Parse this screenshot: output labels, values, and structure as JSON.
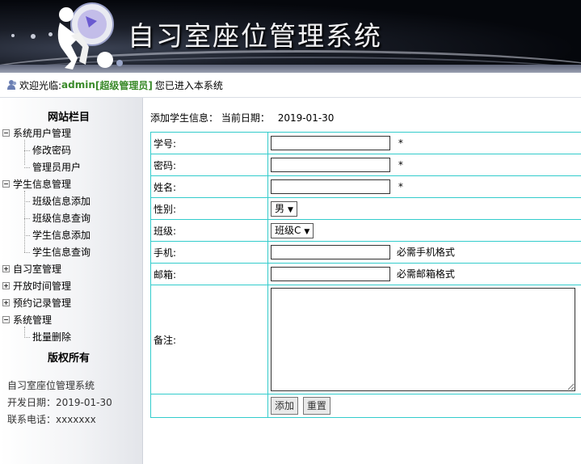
{
  "header": {
    "title": "自习室座位管理系统"
  },
  "welcome": {
    "prefix": "欢迎光临:",
    "username": "admin",
    "role": "[超级管理员]",
    "suffix": "您已进入本系统"
  },
  "sidebar": {
    "title": "网站栏目",
    "groups": [
      {
        "label": "系统用户管理",
        "expanded": true,
        "items": [
          "修改密码",
          "管理员用户"
        ]
      },
      {
        "label": "学生信息管理",
        "expanded": true,
        "items": [
          "班级信息添加",
          "班级信息查询",
          "学生信息添加",
          "学生信息查询"
        ]
      },
      {
        "label": "自习室管理",
        "expanded": false,
        "items": []
      },
      {
        "label": "开放时间管理",
        "expanded": false,
        "items": []
      },
      {
        "label": "预约记录管理",
        "expanded": false,
        "items": []
      },
      {
        "label": "系统管理",
        "expanded": true,
        "items": [
          "批量删除"
        ]
      }
    ],
    "copyright_title": "版权所有",
    "footer": {
      "system_name": "自习室座位管理系统",
      "dev_date": "开发日期：2019-01-30",
      "phone": "联系电话：xxxxxxx"
    }
  },
  "main": {
    "heading": "添加学生信息：",
    "date_label": "当前日期：",
    "date": "2019-01-30",
    "fields": {
      "student_id": {
        "label": "学号:",
        "value": "",
        "required": "*"
      },
      "password": {
        "label": "密码:",
        "value": "",
        "required": "*"
      },
      "name": {
        "label": "姓名:",
        "value": "",
        "required": "*"
      },
      "gender": {
        "label": "性别:",
        "selected": "男"
      },
      "class": {
        "label": "班级:",
        "selected": "班级C"
      },
      "phone": {
        "label": "手机:",
        "value": "",
        "hint": "必需手机格式"
      },
      "email": {
        "label": "邮箱:",
        "value": "",
        "hint": "必需邮箱格式"
      },
      "remark": {
        "label": "备注:",
        "value": ""
      }
    },
    "buttons": {
      "add": "添加",
      "reset": "重置"
    }
  },
  "colors": {
    "table_border": "#33cccc",
    "admin_text": "#3a8a2a",
    "banner_bg": "#05070c"
  }
}
